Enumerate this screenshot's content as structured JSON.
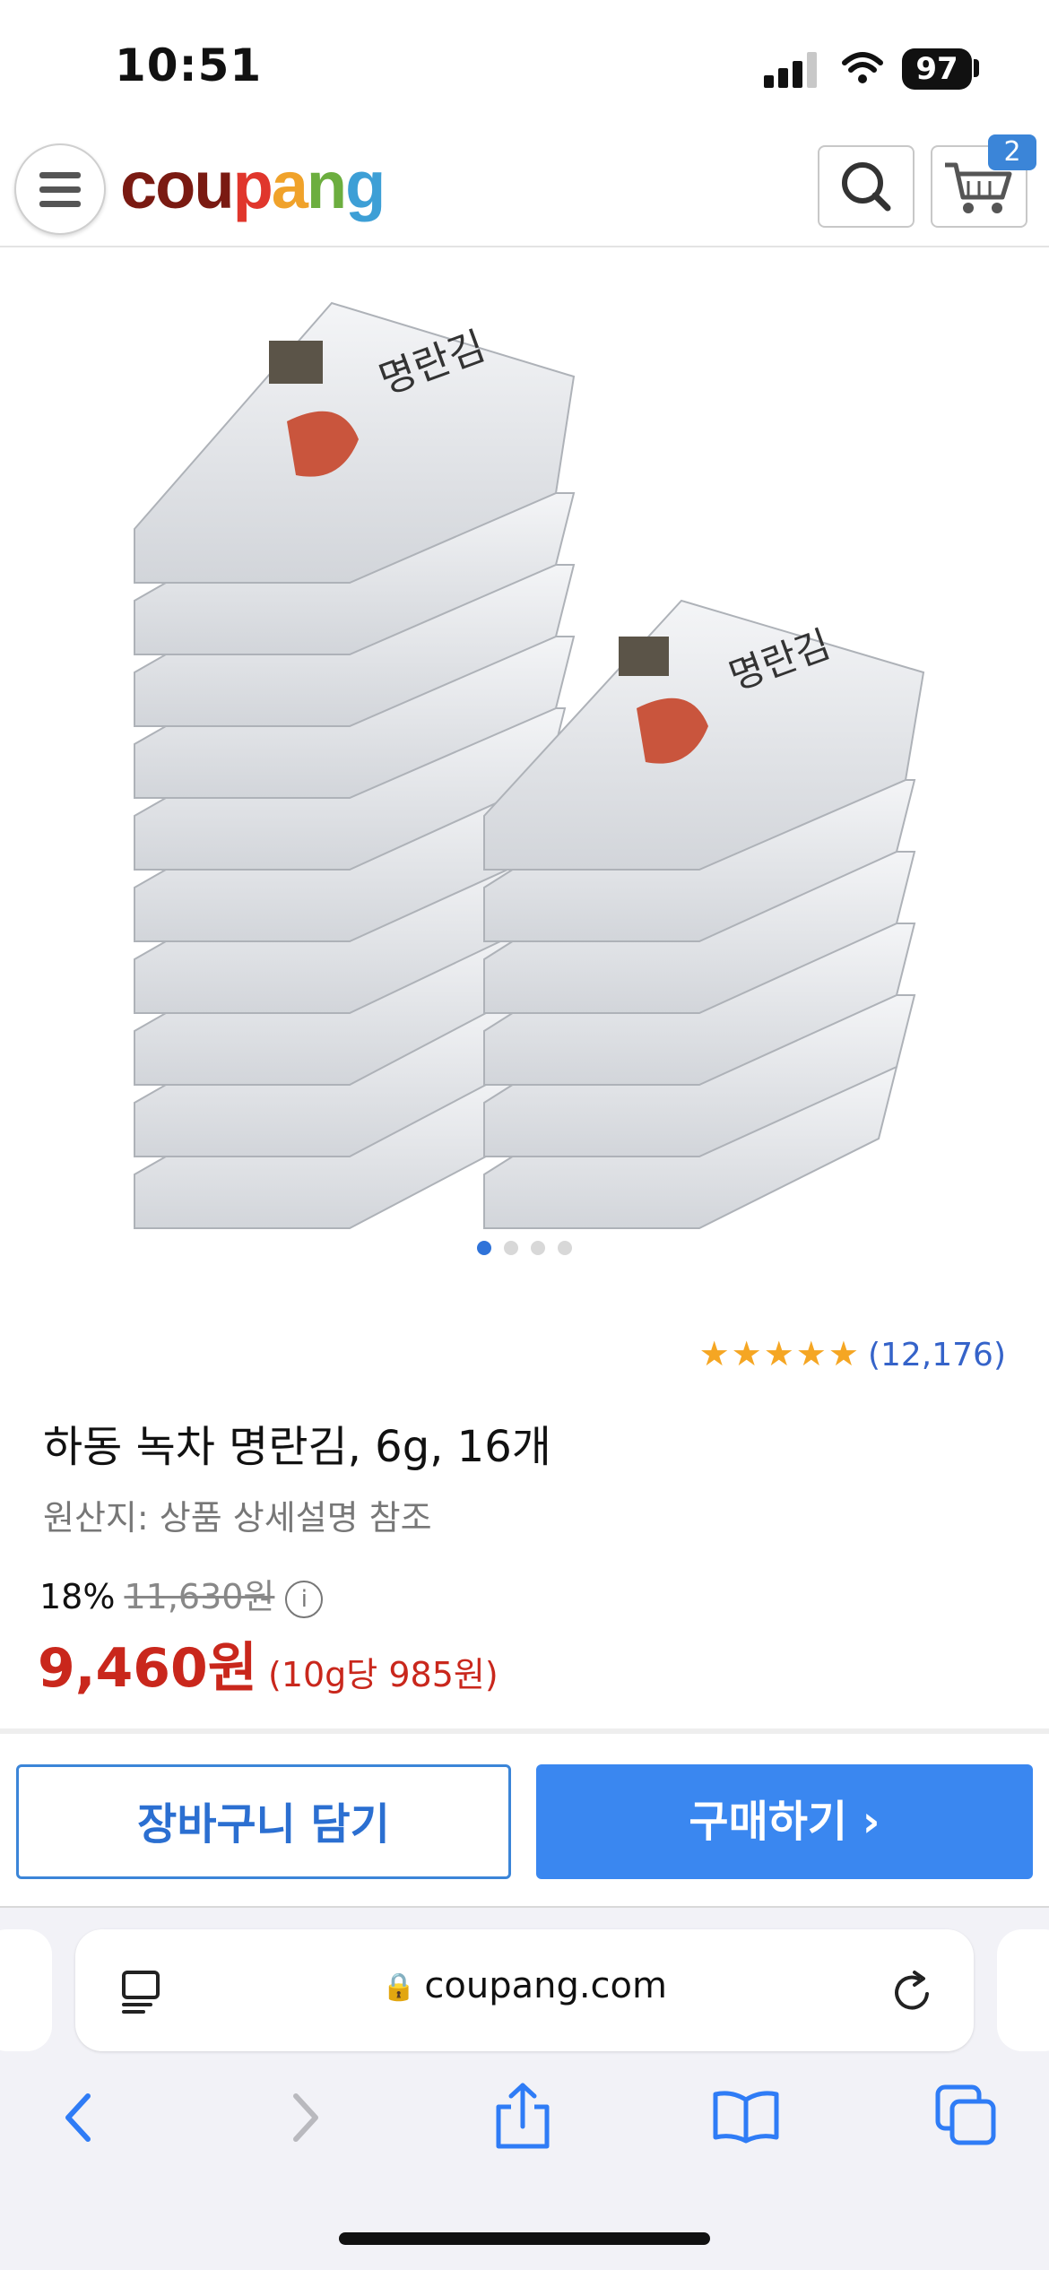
{
  "status_bar": {
    "time": "10:51",
    "battery": "97",
    "icons": [
      "cellular-signal-icon",
      "wifi-icon",
      "battery-icon"
    ]
  },
  "header": {
    "logo_letters": [
      "c",
      "o",
      "u",
      "p",
      "a",
      "n",
      "g"
    ],
    "logo_colors": [
      "#7a1a12",
      "#7a1a12",
      "#7a1a12",
      "#e0362c",
      "#f0a22a",
      "#6cae3f",
      "#3d9fd6"
    ],
    "cart_count": "2",
    "icons": [
      "menu-icon",
      "search-icon",
      "cart-icon"
    ]
  },
  "carousel": {
    "total_images": 4,
    "active_index": 0
  },
  "product": {
    "rating_stars": "★★★★★",
    "rating": 5,
    "review_count": "(12,176)",
    "title": "하동 녹차 명란김, 6g, 16개",
    "origin": "원산지: 상품 상세설명 참조",
    "discount": "18%",
    "original_price": "11,630원",
    "price": "9,460원",
    "unit_price": "(10g당 985원)"
  },
  "actions": {
    "add_to_cart": "장바구니 담기",
    "buy_now": "구매하기 ›"
  },
  "browser": {
    "url": "coupang.com",
    "icons": [
      "reader-mode-icon",
      "lock-icon",
      "reload-icon",
      "back-icon",
      "forward-icon",
      "share-icon",
      "bookmarks-icon",
      "tabs-icon"
    ]
  }
}
